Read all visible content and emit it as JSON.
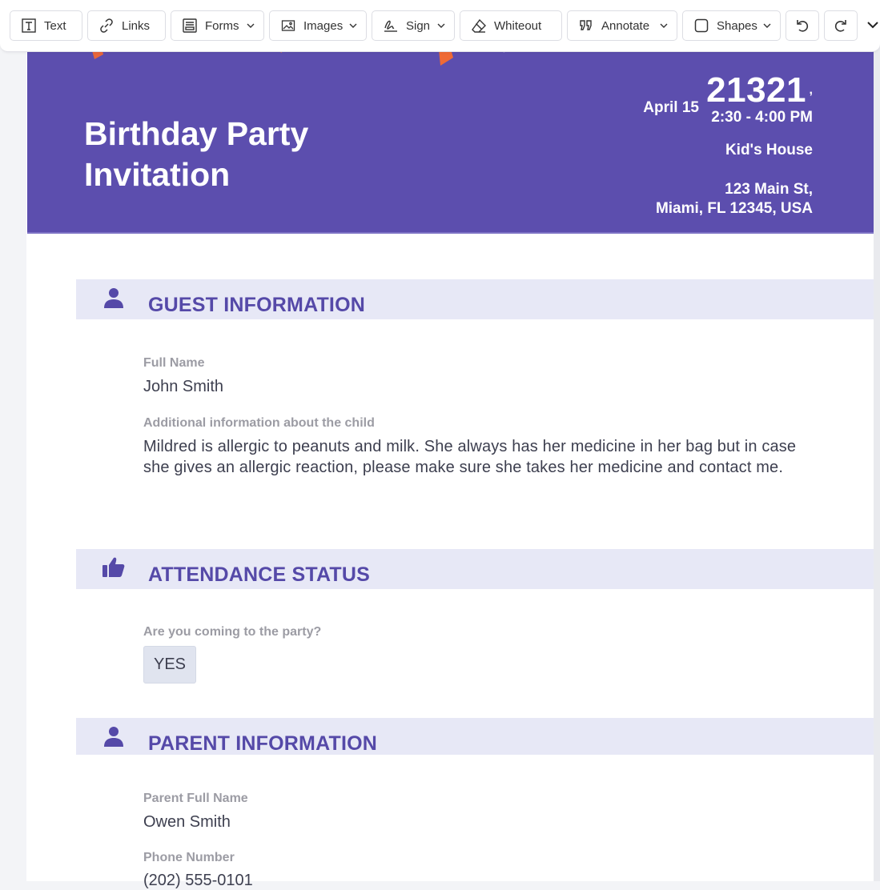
{
  "toolbar": {
    "text": "Text",
    "links": "Links",
    "forms": "Forms",
    "images": "Images",
    "sign": "Sign",
    "whiteout": "Whiteout",
    "annotate": "Annotate",
    "shapes": "Shapes"
  },
  "header": {
    "title": "Birthday Party Invitation",
    "date": "April 15",
    "number": "21321",
    "comma": ",",
    "time": "2:30 - 4:00 PM",
    "place": "Kid's House",
    "address_line1": "123 Main St,",
    "address_line2": "Miami, FL 12345, USA",
    "color": "#5c4eae"
  },
  "sections": {
    "guest": {
      "title": "GUEST INFORMATION",
      "full_name_label": "Full Name",
      "full_name_value": "John Smith",
      "additional_label": "Additional information about the child",
      "additional_value": "Mildred is allergic to peanuts and milk. She always has her medicine in her bag but in case she gives an allergic reaction, please make sure she takes her medicine and contact me."
    },
    "attendance": {
      "title": "ATTENDANCE STATUS",
      "question_label": "Are you coming to the party?",
      "answer": "YES"
    },
    "parent": {
      "title": "PARENT INFORMATION",
      "parent_name_label": "Parent Full Name",
      "parent_name_value": "Owen Smith",
      "phone_label": "Phone Number",
      "phone_value": "(202) 555-0101"
    }
  },
  "icons": {
    "text": "text-tool-icon",
    "links": "link-icon",
    "forms": "form-icon",
    "images": "image-icon",
    "sign": "signature-icon",
    "whiteout": "eraser-icon",
    "annotate": "annotate-icon",
    "shapes": "square-icon",
    "undo": "undo-icon",
    "redo": "redo-icon",
    "more": "chevron-down-icon",
    "guest": "person-icon",
    "attendance": "thumbs-up-icon",
    "parent": "person-icon"
  },
  "accent": "#5549a8"
}
